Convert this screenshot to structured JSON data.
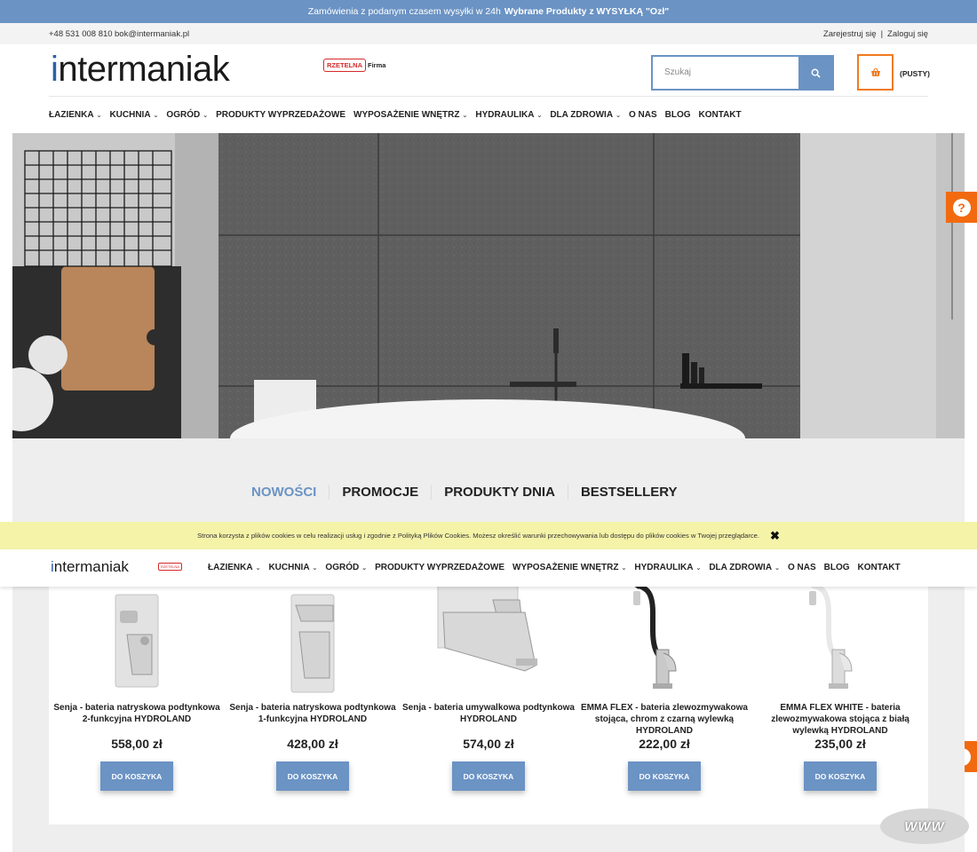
{
  "topbar": {
    "text": "Zamówienia z podanym czasem wysyłki w 24h",
    "bold_text": "Wybrane Produkty z WYSYŁKĄ \"Ozł\""
  },
  "infobar": {
    "phone": "+48 531 008 810",
    "email": "bok@intermaniak.pl",
    "register": "Zarejestruj się",
    "separator": "|",
    "login": "Zaloguj się"
  },
  "header": {
    "logo_i": "i",
    "logo_rest": "ntermaniak",
    "badge_red": "RZETELNA",
    "badge_black": "Firma",
    "search_placeholder": "Szukaj",
    "cart_label": "(PUSTY)"
  },
  "nav": [
    {
      "label": "ŁAZIENKA",
      "chevron": true
    },
    {
      "label": "KUCHNIA",
      "chevron": true
    },
    {
      "label": "OGRÓD",
      "chevron": true
    },
    {
      "label": "PRODUKTY WYPRZEDAŻOWE",
      "chevron": false
    },
    {
      "label": "WYPOSAŻENIE WNĘTRZ",
      "chevron": true
    },
    {
      "label": "HYDRAULIKA",
      "chevron": true
    },
    {
      "label": "DLA ZDROWIA",
      "chevron": true
    },
    {
      "label": "O NAS",
      "chevron": false
    },
    {
      "label": "BLOG",
      "chevron": false
    },
    {
      "label": "KONTAKT",
      "chevron": false
    }
  ],
  "tabs": [
    "NOWOŚCI",
    "PROMOCJE",
    "PRODUKTY DNIA",
    "BESTSELLERY"
  ],
  "cookie": {
    "text": "Strona korzysta z plików cookies w celu realizacji usług i zgodnie z Polityką Plików Cookies. Możesz określić warunki przechowywania lub dostępu do plików cookies w Twojej przeglądarce.",
    "close": "✖"
  },
  "products": [
    {
      "name": "Senja - bateria natryskowa podtynkowa 2-funkcyjna HYDROLAND",
      "price": "558,00 zł",
      "button": "DO KOSZYKA"
    },
    {
      "name": "Senja - bateria natryskowa podtynkowa 1-funkcyjna HYDROLAND",
      "price": "428,00 zł",
      "button": "DO KOSZYKA"
    },
    {
      "name": "Senja - bateria umywalkowa podtynkowa HYDROLAND",
      "price": "574,00 zł",
      "button": "DO KOSZYKA"
    },
    {
      "name": "EMMA FLEX - bateria zlewozmywakowa stojąca, chrom z czarną wylewką HYDROLAND",
      "price": "222,00 zł",
      "button": "DO KOSZYKA"
    },
    {
      "name": "EMMA FLEX WHITE - bateria zlewozmywakowa stojąca z białą wylewką HYDROLAND",
      "price": "235,00 zł",
      "button": "DO KOSZYKA"
    }
  ],
  "help": "?",
  "watermark": "WWW",
  "colors": {
    "accent": "#6b93c4",
    "orange": "#f26a10",
    "cookie_bg": "#f5f3a8"
  }
}
